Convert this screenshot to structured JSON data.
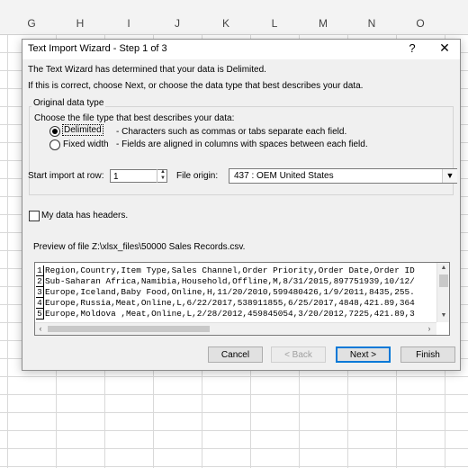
{
  "columns": [
    "G",
    "H",
    "I",
    "J",
    "K",
    "L",
    "M",
    "N",
    "O"
  ],
  "dialog": {
    "title": "Text Import Wizard - Step 1 of 3",
    "help_label": "?",
    "close_label": "✕",
    "intro_line1": "The Text Wizard has determined that your data is Delimited.",
    "intro_line2": "If this is correct, choose Next, or choose the data type that best describes your data.",
    "group_title": "Original data type",
    "choose_label": "Choose the file type that best describes your data:",
    "delimited_label": "Delimited",
    "delimited_desc": "- Characters such as commas or tabs separate each field.",
    "fixed_label": "Fixed width",
    "fixed_desc": "- Fields are aligned in columns with spaces between each field.",
    "start_row_label": "Start import at row:",
    "start_row_value": "1",
    "file_origin_label": "File origin:",
    "file_origin_value": "437 : OEM United States",
    "headers_label": "My data has headers.",
    "preview_label": "Preview of file Z:\\xlsx_files\\50000 Sales Records.csv.",
    "preview_rows": [
      {
        "num": "1",
        "text": "Region,Country,Item Type,Sales Channel,Order Priority,Order Date,Order ID"
      },
      {
        "num": "2",
        "text": "Sub-Saharan Africa,Namibia,Household,Offline,M,8/31/2015,897751939,10/12/"
      },
      {
        "num": "3",
        "text": "Europe,Iceland,Baby Food,Online,H,11/20/2010,599480426,1/9/2011,8435,255."
      },
      {
        "num": "4",
        "text": "Europe,Russia,Meat,Online,L,6/22/2017,538911855,6/25/2017,4848,421.89,364"
      },
      {
        "num": "5",
        "text": "Europe,Moldova ,Meat,Online,L,2/28/2012,459845054,3/20/2012,7225,421.89,3"
      }
    ],
    "cancel_label": "Cancel",
    "back_label": "< Back",
    "next_label": "Next >",
    "finish_label": "Finish"
  }
}
